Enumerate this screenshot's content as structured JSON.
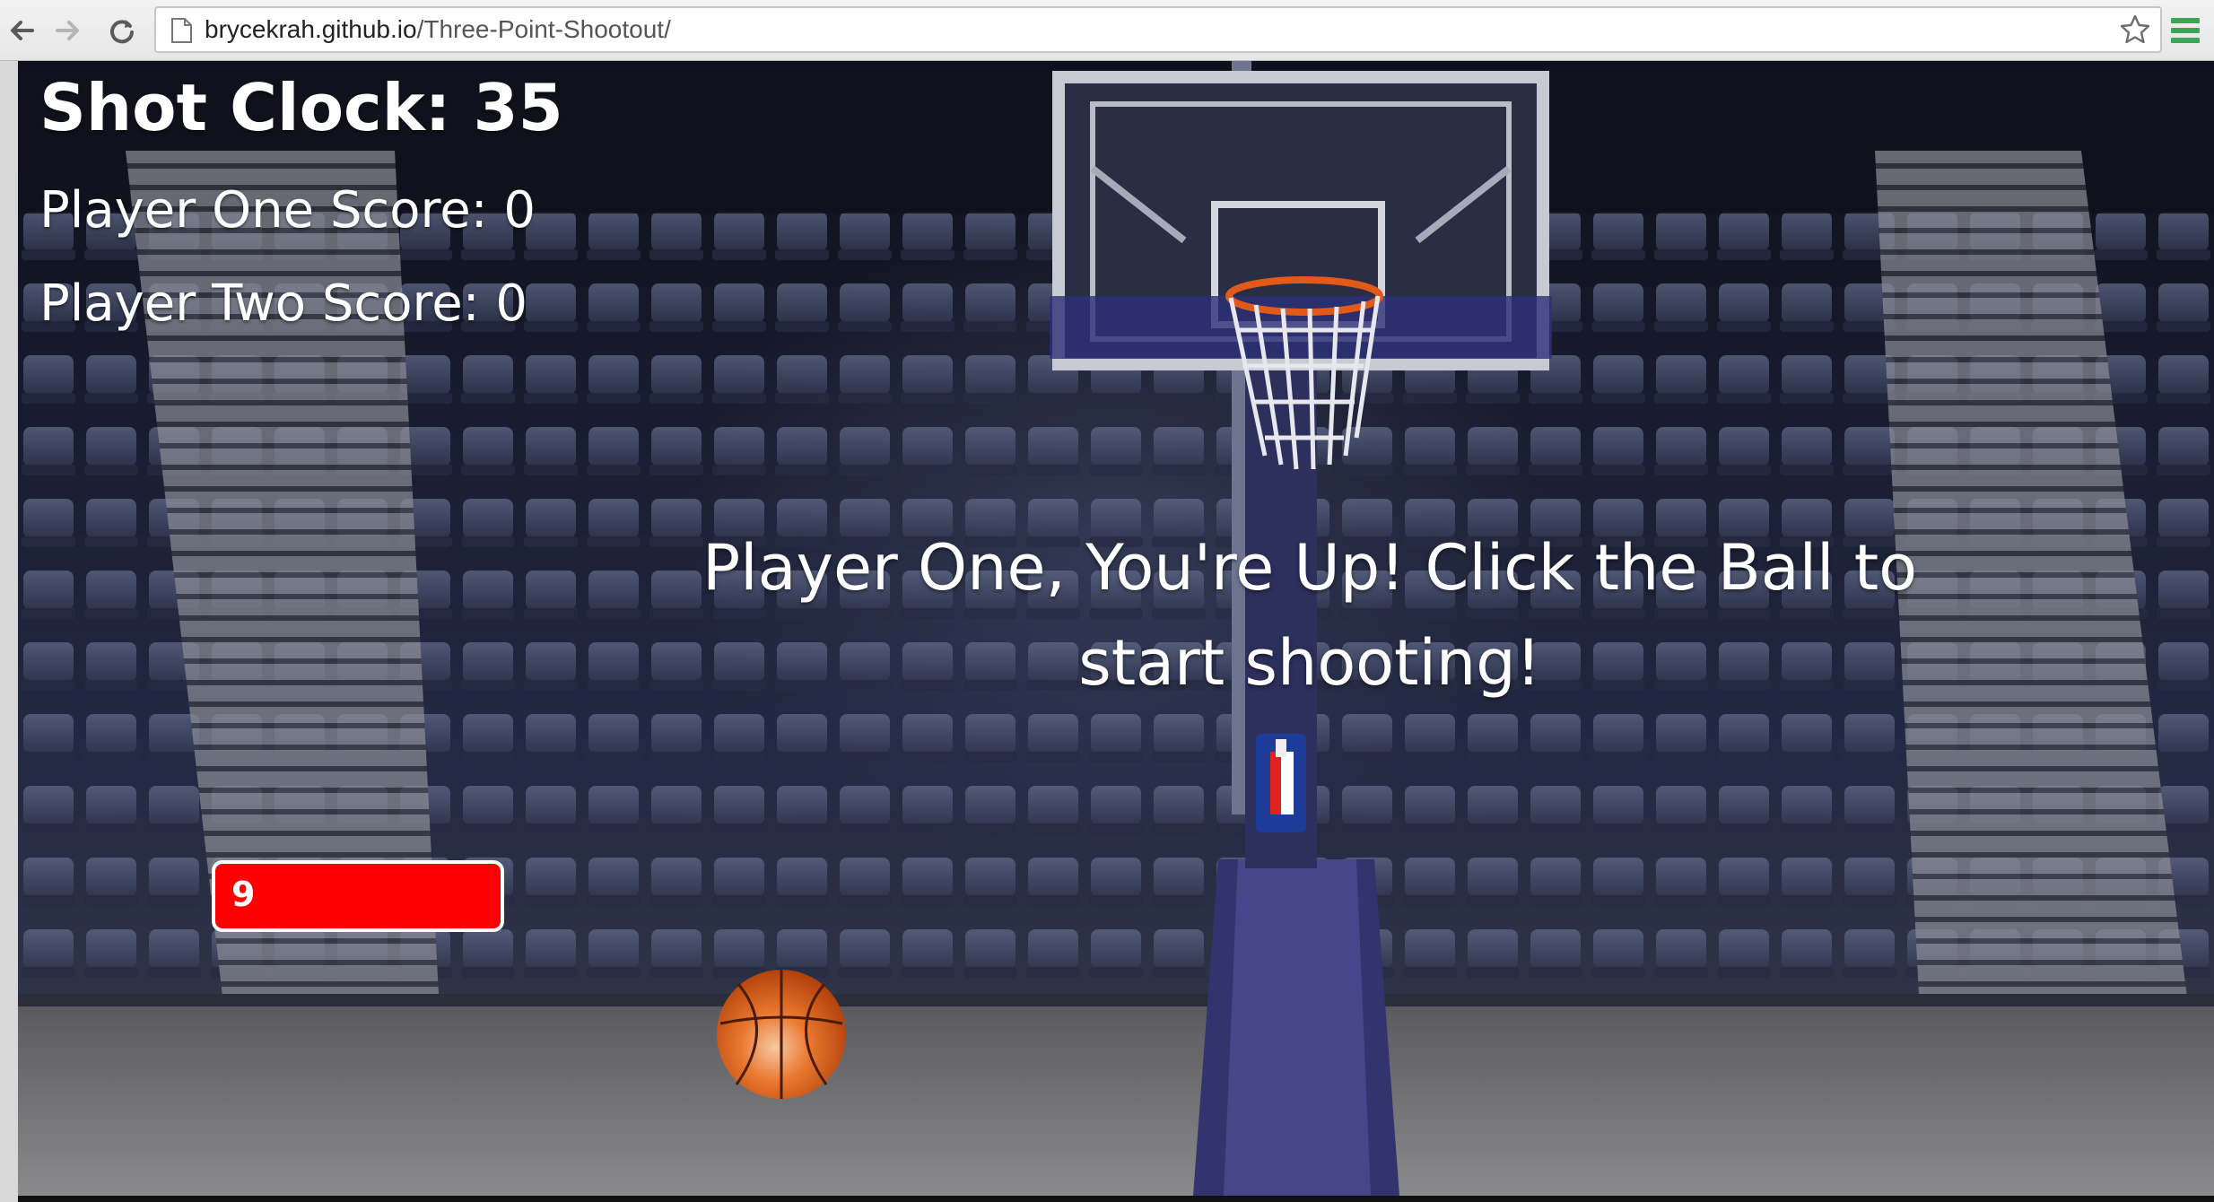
{
  "browser": {
    "url_host": "brycekrah.github.io",
    "url_path": "/Three-Point-Shootout/",
    "icons": {
      "back": "back-arrow-icon",
      "forward": "forward-arrow-icon",
      "reload": "reload-icon",
      "page": "page-icon",
      "bookmark": "star-icon",
      "menu": "hamburger-menu-icon"
    }
  },
  "game": {
    "shot_clock": "Shot Clock: 35",
    "player_one_score": "Player One Score: 0",
    "player_two_score": "Player Two Score: 0",
    "message": "Player One, You're Up! Click the Ball to start shooting!",
    "power_bar_label": "9",
    "colors": {
      "power_bar": "#ff0000",
      "ball": "#e2661f",
      "text": "#ffffff"
    }
  }
}
